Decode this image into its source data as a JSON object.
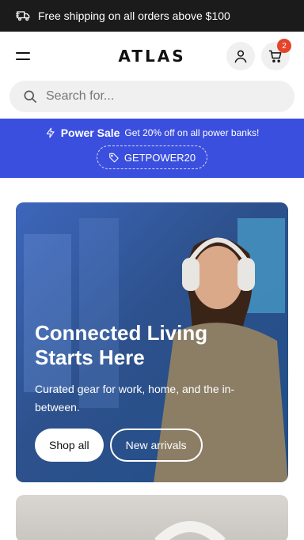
{
  "topbar": {
    "text": "Free shipping on all orders above $100",
    "icon": "truck-icon"
  },
  "header": {
    "logo": "ATLAS",
    "cart_count": "2"
  },
  "search": {
    "placeholder": "Search for..."
  },
  "promo": {
    "title": "Power Sale",
    "subtitle": "Get 20% off on all power banks!",
    "code": "GETPOWER20",
    "bg": "#3b4fde"
  },
  "hero": {
    "title": "Connected Living Starts Here",
    "subtitle": "Curated gear for work, home, and the in-between.",
    "btn_primary": "Shop all",
    "btn_secondary": "New arrivals"
  }
}
